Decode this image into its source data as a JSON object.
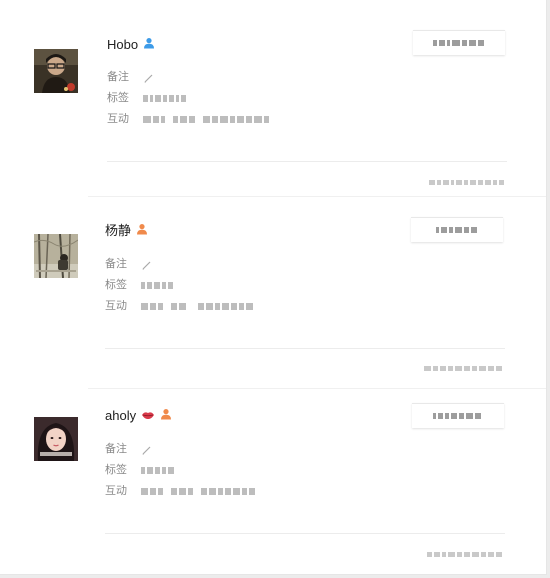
{
  "users": [
    {
      "name": "Hobo",
      "badge_icon": "user-blue-icon",
      "badge_color": "#3d9be8",
      "remark_label": "备注",
      "tags_label": "标签",
      "interaction_label": "互动",
      "action_icon": "edit-icon"
    },
    {
      "name": "杨静",
      "badge_icon": "user-orange-icon",
      "badge_color": "#f08a4b",
      "remark_label": "备注",
      "tags_label": "标签",
      "interaction_label": "互动",
      "action_icon": "edit-icon"
    },
    {
      "name": "aholy",
      "lips_icon": "lips-icon",
      "lips_color": "#d93a4a",
      "badge_icon": "user-orange-icon",
      "badge_color": "#f08a4b",
      "remark_label": "备注",
      "tags_label": "标签",
      "interaction_label": "互动",
      "action_icon": "edit-icon"
    }
  ]
}
